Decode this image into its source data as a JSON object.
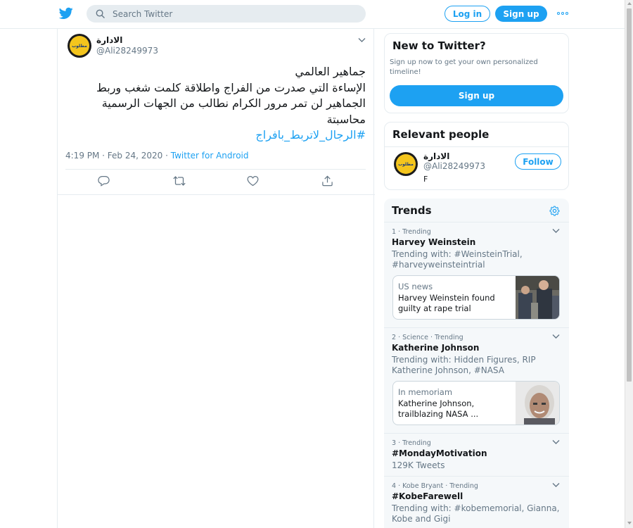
{
  "header": {
    "search_placeholder": "Search Twitter",
    "login_label": "Log in",
    "signup_label": "Sign up",
    "brand_color": "#1da1f2"
  },
  "tweet": {
    "author_name": "الادارة",
    "author_handle": "@Ali28249973",
    "avatar_text": "مطلوب",
    "lines": [
      "جماهير العالمي",
      "الإساءة التي صدرت من الفراج واطلاقة كلمت شغب وربط",
      "الجماهير لن تمر مرور الكرام نطالب من الجهات الرسمية",
      "محاسبتة"
    ],
    "hashtag": "#الرجال_لاتربط_بافراج",
    "time": "4:19 PM · Feb 24, 2020 · ",
    "source": "Twitter for Android"
  },
  "new_to_twitter": {
    "title": "New to Twitter?",
    "text": "Sign up now to get your own personalized timeline!",
    "button": "Sign up"
  },
  "relevant": {
    "title": "Relevant people",
    "name": "الادارة",
    "handle": "@Ali28249973",
    "bio": "F",
    "follow": "Follow"
  },
  "trends": {
    "title": "Trends",
    "items": [
      {
        "context": "1 · Trending",
        "name": "Harvey Weinstein",
        "sub": "Trending with: #WeinsteinTrial, #harveyweinsteintrial",
        "news_source": "US news",
        "news_title": "Harvey Weinstein found guilty at rape trial"
      },
      {
        "context": "2 · Science · Trending",
        "name": "Katherine Johnson",
        "sub": "Trending with: Hidden Figures, RIP Katherine Johnson, #NASA",
        "news_source": "In memoriam",
        "news_title": "Katherine Johnson, trailblazing NASA ..."
      },
      {
        "context": "3 · Trending",
        "name": "#MondayMotivation",
        "sub": "129K Tweets"
      },
      {
        "context": "4 · Kobe Bryant · Trending",
        "name": "#KobeFarewell",
        "sub": "Trending with: #kobememorial, Gianna, Kobe and Gigi"
      }
    ]
  }
}
